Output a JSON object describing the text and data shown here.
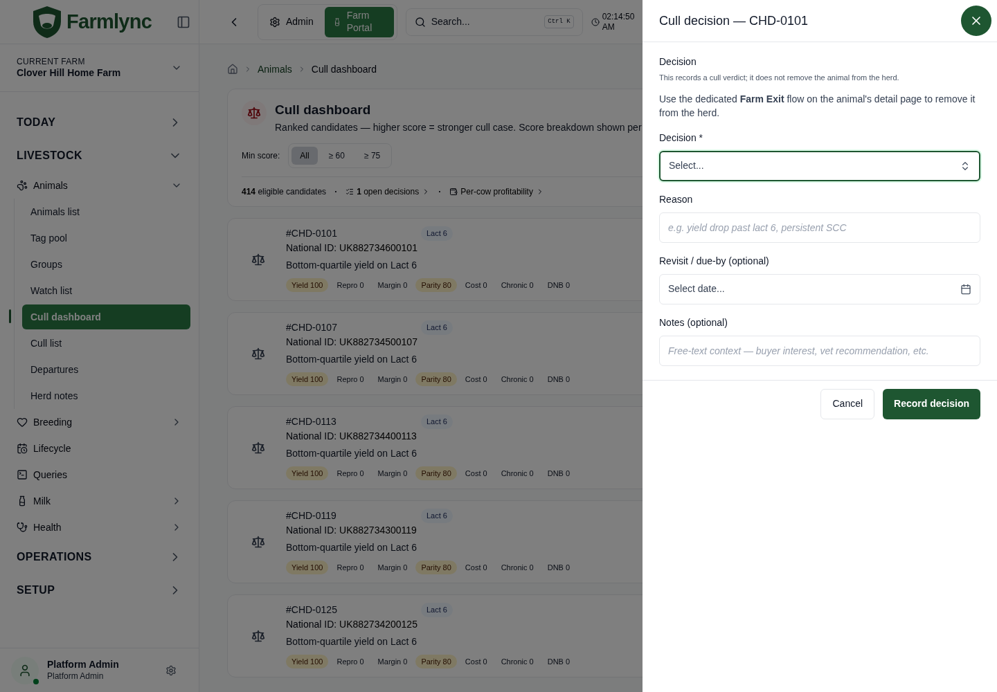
{
  "sidebar": {
    "logo": "Farmlync",
    "current_farm": {
      "label": "CURRENT FARM",
      "name": "Clover Hill Home Farm"
    },
    "sections": [
      {
        "label": "TODAY",
        "expanded": false
      },
      {
        "label": "LIVESTOCK",
        "expanded": true,
        "items": [
          {
            "label": "Animals",
            "expanded": true,
            "children": [
              {
                "label": "Animals list",
                "selected": false
              },
              {
                "label": "Tag pool",
                "selected": false
              },
              {
                "label": "Groups",
                "selected": false
              },
              {
                "label": "Watch list",
                "selected": false
              },
              {
                "label": "Cull dashboard",
                "selected": true
              },
              {
                "label": "Cull list",
                "selected": false
              },
              {
                "label": "Departures",
                "selected": false
              },
              {
                "label": "Herd notes",
                "selected": false
              }
            ]
          },
          {
            "label": "Breeding",
            "expanded": false
          },
          {
            "label": "Lifecycle"
          },
          {
            "label": "Queries"
          },
          {
            "label": "Milk",
            "expanded": false
          },
          {
            "label": "Health",
            "expanded": false
          }
        ]
      },
      {
        "label": "OPERATIONS",
        "expanded": false
      },
      {
        "label": "SETUP",
        "expanded": false
      }
    ],
    "user": {
      "name": "Platform Admin",
      "role": "Platform Admin",
      "online": true
    }
  },
  "topbar": {
    "tabs": [
      {
        "label": "Admin",
        "selected": false
      },
      {
        "label": "Farm Portal",
        "selected": true
      }
    ],
    "search": {
      "placeholder": "Search...",
      "shortcut": "Ctrl K"
    },
    "time": "02:14:50 AM"
  },
  "breadcrumb": [
    "Animals",
    "Cull dashboard"
  ],
  "page": {
    "title": "Cull dashboard",
    "subtitle": "Ranked candidates — higher score = stronger cull case. Score breakdown shown per",
    "filter": {
      "label": "Min score:",
      "options": [
        {
          "label": "All",
          "selected": true
        },
        {
          "label": "≥ 60",
          "selected": false
        },
        {
          "label": "≥ 75",
          "selected": false
        }
      ]
    },
    "stats": {
      "separators": [
        "·",
        "·"
      ],
      "count": "414",
      "count_label": "eligible candidates",
      "open_count": "1",
      "open_label": "open decisions",
      "profitability": "Per-cow profitability"
    },
    "candidates": [
      {
        "tag": "#CHD-0101",
        "id_label": "National ID:",
        "national_id": "UK882734600101",
        "reason": "Bottom-quartile yield on Lact 6",
        "lact": "Lact 6",
        "scores": [
          {
            "label": "Yield 100",
            "highlighted": true
          },
          {
            "label": "Repro 0",
            "highlighted": false
          },
          {
            "label": "Margin 0",
            "highlighted": false
          },
          {
            "label": "Parity 80",
            "highlighted": true
          },
          {
            "label": "Cost 0",
            "highlighted": false
          },
          {
            "label": "Chronic 0",
            "highlighted": false
          },
          {
            "label": "DNB 0",
            "highlighted": false
          }
        ]
      },
      {
        "tag": "#CHD-0107",
        "id_label": "National ID:",
        "national_id": "UK882734500107",
        "reason": "Bottom-quartile yield on Lact 6",
        "lact": "Lact 6",
        "scores": [
          {
            "label": "Yield 100",
            "highlighted": true
          },
          {
            "label": "Repro 0",
            "highlighted": false
          },
          {
            "label": "Margin 0",
            "highlighted": false
          },
          {
            "label": "Parity 80",
            "highlighted": true
          },
          {
            "label": "Cost 0",
            "highlighted": false
          },
          {
            "label": "Chronic 0",
            "highlighted": false
          },
          {
            "label": "DNB 0",
            "highlighted": false
          }
        ]
      },
      {
        "tag": "#CHD-0113",
        "id_label": "National ID:",
        "national_id": "UK882734400113",
        "reason": "Bottom-quartile yield on Lact 6",
        "lact": "Lact 6",
        "scores": [
          {
            "label": "Yield 100",
            "highlighted": true
          },
          {
            "label": "Repro 0",
            "highlighted": false
          },
          {
            "label": "Margin 0",
            "highlighted": false
          },
          {
            "label": "Parity 80",
            "highlighted": true
          },
          {
            "label": "Cost 0",
            "highlighted": false
          },
          {
            "label": "Chronic 0",
            "highlighted": false
          },
          {
            "label": "DNB 0",
            "highlighted": false
          }
        ]
      },
      {
        "tag": "#CHD-0119",
        "id_label": "National ID:",
        "national_id": "UK882734300119",
        "reason": "Bottom-quartile yield on Lact 6",
        "lact": "Lact 6",
        "scores": [
          {
            "label": "Yield 100",
            "highlighted": true
          },
          {
            "label": "Repro 0",
            "highlighted": false
          },
          {
            "label": "Margin 0",
            "highlighted": false
          },
          {
            "label": "Parity 80",
            "highlighted": true
          },
          {
            "label": "Cost 0",
            "highlighted": false
          },
          {
            "label": "Chronic 0",
            "highlighted": false
          },
          {
            "label": "DNB 0",
            "highlighted": false
          }
        ]
      },
      {
        "tag": "#CHD-0125",
        "id_label": "National ID:",
        "national_id": "UK882734200125",
        "reason": "Bottom-quartile yield on Lact 6",
        "lact": "Lact 6",
        "scores": [
          {
            "label": "Yield 100",
            "highlighted": true
          },
          {
            "label": "Repro 0",
            "highlighted": false
          },
          {
            "label": "Margin 0",
            "highlighted": false
          },
          {
            "label": "Parity 80",
            "highlighted": true
          },
          {
            "label": "Cost 0",
            "highlighted": false
          },
          {
            "label": "Chronic 0",
            "highlighted": false
          },
          {
            "label": "DNB 0",
            "highlighted": false
          }
        ]
      }
    ]
  },
  "drawer": {
    "title": "Cull decision — CHD-0101",
    "section": "Decision",
    "note": "This records a cull verdict; it does not remove the animal from the herd.",
    "help": "Use the dedicated **Farm Exit** flow on the animal's detail page to remove it from the herd.",
    "fields": [
      {
        "kind": "select",
        "label": "Decision *",
        "placeholder": "Select...",
        "focused": true
      },
      {
        "kind": "text",
        "label": "Reason",
        "placeholder": "e.g. yield drop past lact 6, persistent SCC",
        "focused": false
      },
      {
        "kind": "date",
        "label": "Revisit / due-by (optional)",
        "placeholder": "Select date...",
        "focused": false
      },
      {
        "kind": "text",
        "label": "Notes (optional)",
        "placeholder": "Free-text context — buyer interest, vet recommendation, etc.",
        "focused": false
      }
    ],
    "buttons": {
      "cancel": "Cancel",
      "submit": "Record decision"
    }
  }
}
